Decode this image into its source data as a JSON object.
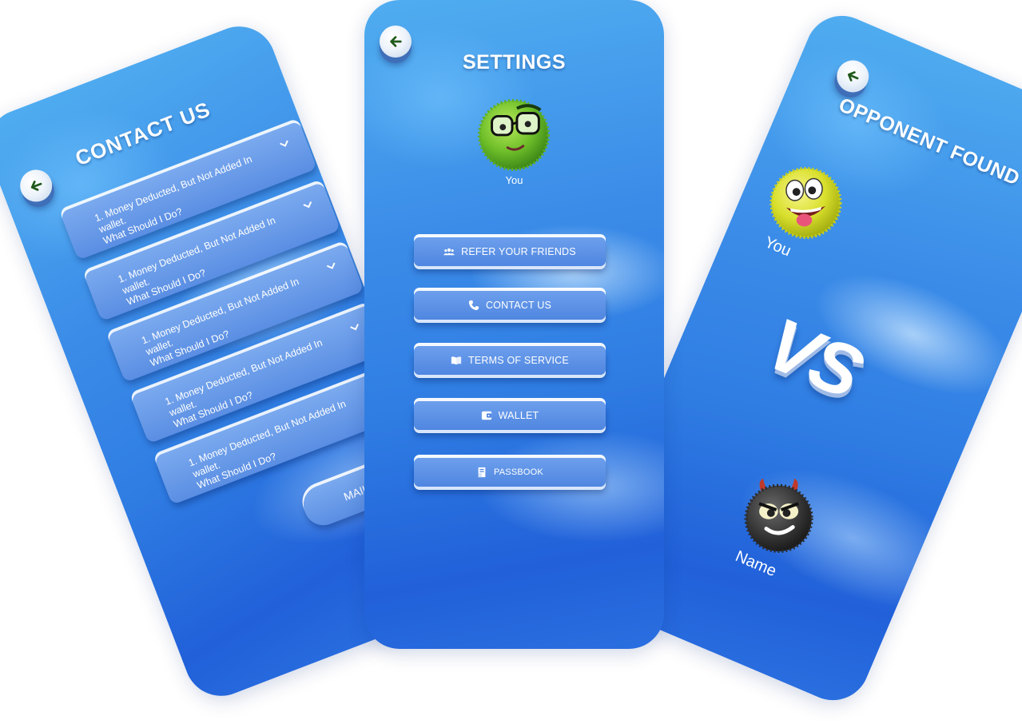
{
  "contact_screen": {
    "title": "CONTACT US",
    "faq_items": [
      {
        "line1": "1. Money Deducted, But Not Added In wallet.",
        "line2": "What Should I Do?"
      },
      {
        "line1": "1. Money Deducted, But Not Added In wallet.",
        "line2": "What Should I Do?"
      },
      {
        "line1": "1. Money Deducted, But Not Added In wallet.",
        "line2": "What Should I Do?"
      },
      {
        "line1": "1. Money Deducted, But Not Added In wallet.",
        "line2": "What Should I Do?"
      },
      {
        "line1": "1. Money Deducted, But Not Added In wallet.",
        "line2": "What Should I Do?"
      }
    ],
    "mail_button": "MAIL US"
  },
  "settings_screen": {
    "title": "SETTINGS",
    "avatar_label": "You",
    "menu": [
      {
        "label": "REFER YOUR FRIENDS",
        "icon": "users-icon"
      },
      {
        "label": "CONTACT US",
        "icon": "phone-icon"
      },
      {
        "label": "TERMS OF SERVICE",
        "icon": "book-icon"
      },
      {
        "label": "WALLET",
        "icon": "wallet-icon"
      },
      {
        "label": "PASSBOOK",
        "icon": "passbook-icon"
      }
    ]
  },
  "opponent_screen": {
    "title": "OPPONENT FOUND",
    "player_label": "You",
    "vs_text": "VS",
    "opponent_label": "Name"
  },
  "colors": {
    "background_top": "#50adf0",
    "background_bottom": "#2160d9",
    "button_fill": "#5a8ee3",
    "back_arrow": "#1f5a1a"
  }
}
